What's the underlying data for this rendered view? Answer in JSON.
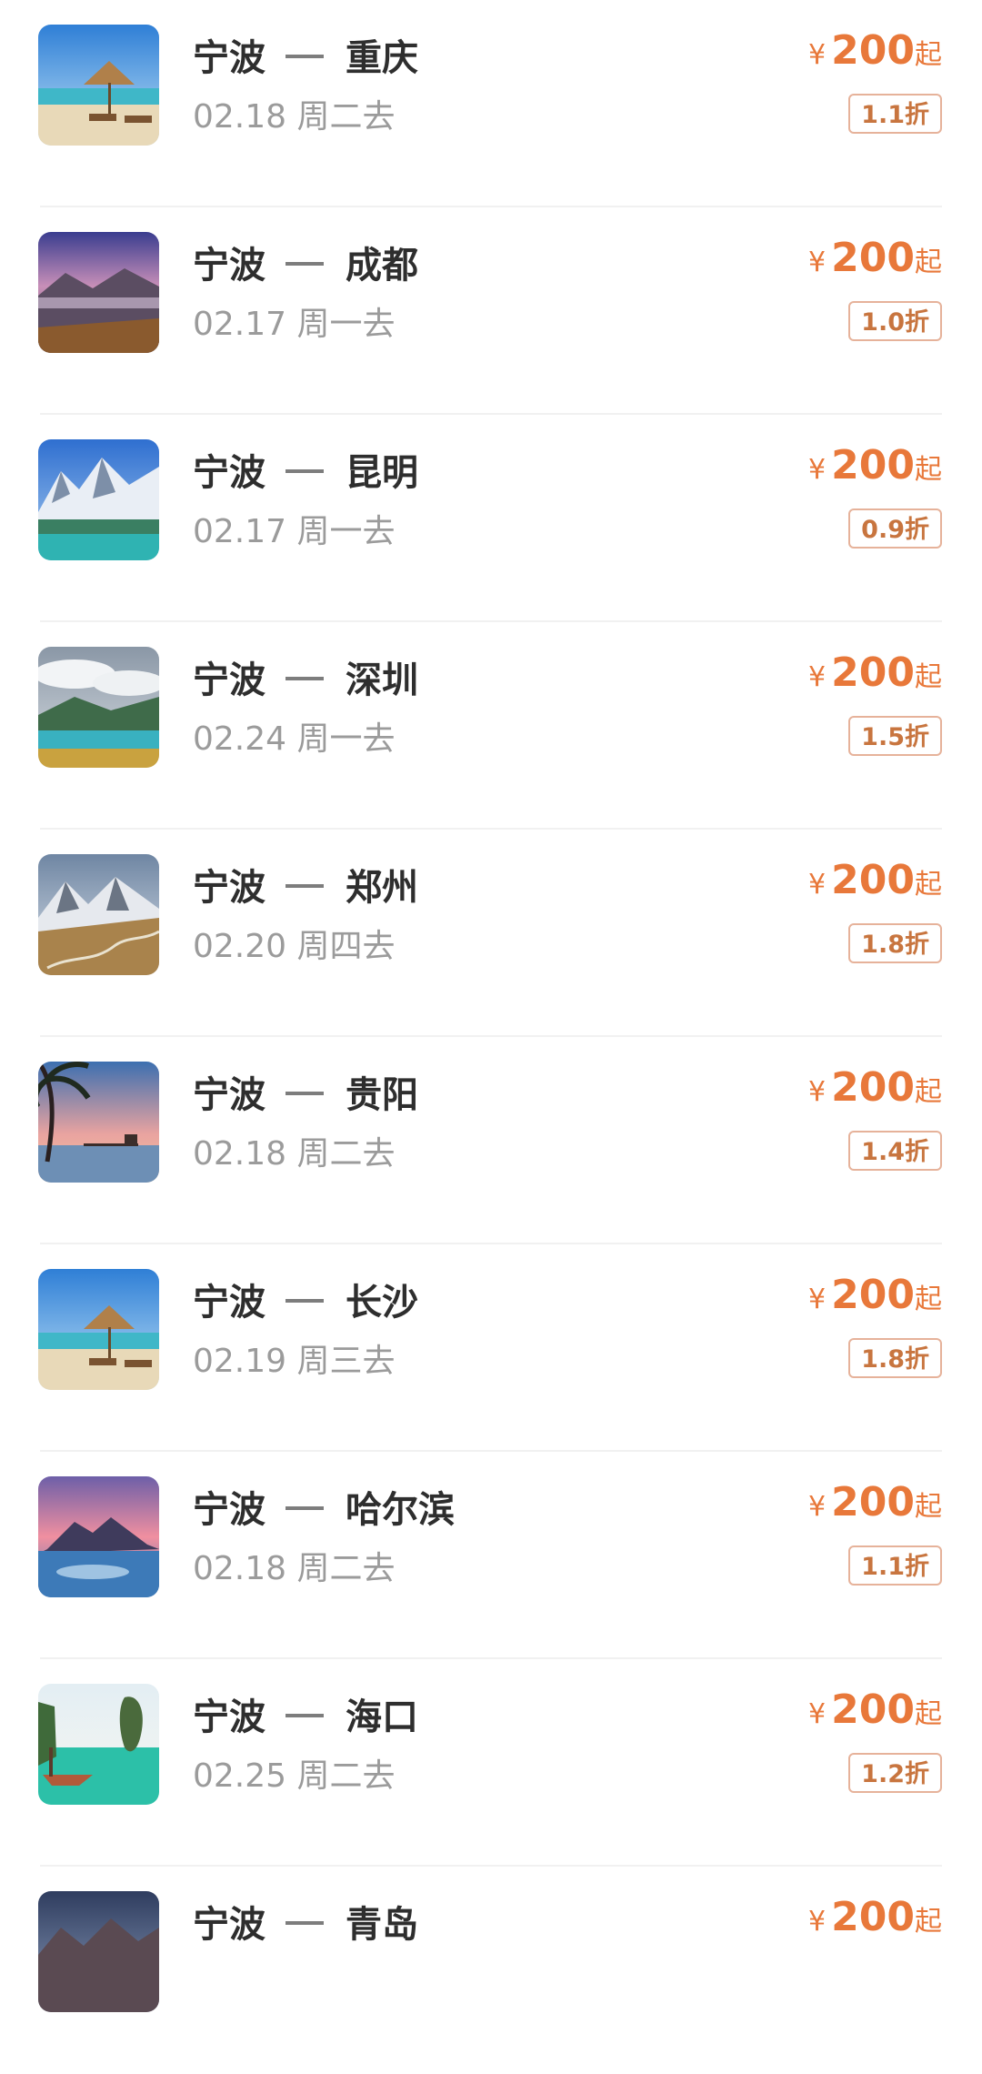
{
  "currency_symbol": "¥",
  "price_suffix": "起",
  "origin": "宁波",
  "accent_color": "#e8783a",
  "items": [
    {
      "destination": "重庆",
      "date": "02.18 周二去",
      "price": "200",
      "discount": "1.1折",
      "thumb": "beach-umbrella"
    },
    {
      "destination": "成都",
      "date": "02.17 周一去",
      "price": "200",
      "discount": "1.0折",
      "thumb": "purple-mountain-valley"
    },
    {
      "destination": "昆明",
      "date": "02.17 周一去",
      "price": "200",
      "discount": "0.9折",
      "thumb": "snow-mountain-lake"
    },
    {
      "destination": "深圳",
      "date": "02.24 周一去",
      "price": "200",
      "discount": "1.5折",
      "thumb": "cloudy-lake-forest"
    },
    {
      "destination": "郑州",
      "date": "02.20 周四去",
      "price": "200",
      "discount": "1.8折",
      "thumb": "mountain-road"
    },
    {
      "destination": "贵阳",
      "date": "02.18 周二去",
      "price": "200",
      "discount": "1.4折",
      "thumb": "palm-sunset-pier"
    },
    {
      "destination": "长沙",
      "date": "02.19 周三去",
      "price": "200",
      "discount": "1.8折",
      "thumb": "beach-umbrella"
    },
    {
      "destination": "哈尔滨",
      "date": "02.18 周二去",
      "price": "200",
      "discount": "1.1折",
      "thumb": "pink-sunset-coast"
    },
    {
      "destination": "海口",
      "date": "02.25 周二去",
      "price": "200",
      "discount": "1.2折",
      "thumb": "tropical-boat-cove"
    },
    {
      "destination": "青岛",
      "date": "",
      "price": "200",
      "discount": "",
      "thumb": "dusk-mountains"
    }
  ]
}
